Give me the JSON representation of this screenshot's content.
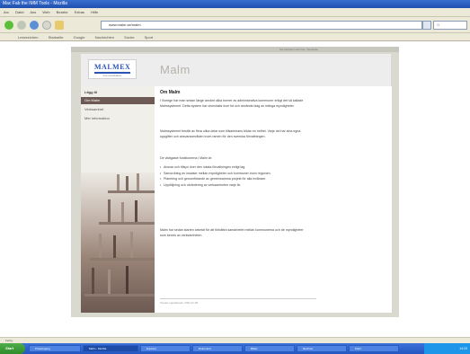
{
  "browser": {
    "title": "Mac Fab the IMM Tools - Mozilla",
    "menu": [
      "Arc",
      "Datei",
      "Ans",
      "Web",
      "Bearbe",
      "Extras",
      "Hilfe"
    ],
    "address": "www.malm.se/malm",
    "search_placeholder": "G",
    "bookmarks": [
      "Lesezeichen",
      "Startseite",
      "Google",
      "Nachrichten",
      "Suche",
      "Sport"
    ],
    "page_strip": "Sie befinden sich hier: Startseite",
    "status": "Fertig"
  },
  "site": {
    "logo_text": "MALMEX",
    "logo_sub": "Kommunikation",
    "page_title": "Malm",
    "sidebar": {
      "heading": "Lägg til",
      "items": [
        "Om Malm",
        "Verksamhet",
        "Mer information"
      ],
      "active_index": 0
    },
    "content": {
      "title": "Om Malm",
      "paragraphs": [
        "I Sverige har man sedan länge använt olika former av administrativa kommuner enligt det så kallade Malmsystemet. Detta system har utvecklats över tid och används idag av många myndigheter.",
        "Malmsystemet består av flera olika delar som tillsammans bildar en helhet. Varje del har sina egna uppgifter och ansvarsområden inom ramen för den svenska förvaltningen.",
        "De viktigaste funktionerna i Malm är:"
      ],
      "list": [
        "Ansvar och tillsyn över den lokala förvaltningen enligt lag.",
        "Samordning av insatser mellan myndigheter och kommuner inom regionen.",
        "Planering och genomförande av gemensamma projekt för alla invånare.",
        "Uppföljning och utvärdering av verksamheten varje år."
      ],
      "closing": "Malm har sedan starten arbetat för att förbättra samarbetet mellan kommunerna och de myndigheter som berörs av verksamheten.",
      "footer": "Senast uppdaterad: 2004-11-08"
    }
  },
  "taskbar": {
    "start_label": "Start",
    "tasks": [
      "Posteingang",
      "Malm - Mozilla",
      "Explorer",
      "Dokument",
      "Bilder",
      "Rechner",
      "Paint"
    ],
    "active_index": 1,
    "clock": "14:23"
  },
  "colors": {
    "accent": "#2b55b4",
    "sidebar_active": "#6e5a55",
    "page_bg": "#dad9d0"
  }
}
